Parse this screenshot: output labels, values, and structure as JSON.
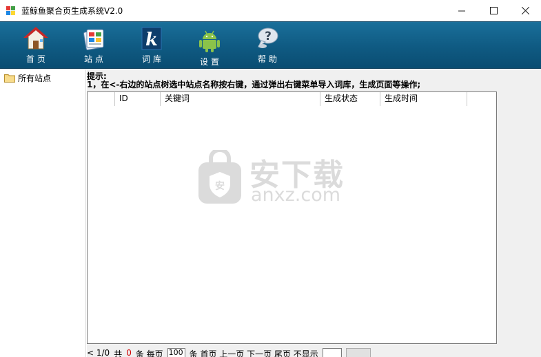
{
  "window": {
    "title": "蓝鲸鱼聚合页生成系统V2.0",
    "minimize_glyph": "—",
    "maximize_glyph": "☐",
    "close_glyph": "✕"
  },
  "toolbar": {
    "items": [
      {
        "label": "首页",
        "icon": "home-icon"
      },
      {
        "label": "站点",
        "icon": "sites-icon"
      },
      {
        "label": "词库",
        "icon": "k-icon"
      },
      {
        "label": "设置",
        "icon": "android-icon"
      },
      {
        "label": "帮助",
        "icon": "help-bubble-icon"
      }
    ]
  },
  "tree": {
    "root_label": "所有站点"
  },
  "hint": {
    "title": "提示:",
    "body": "1，在<-右边的站点树选中站点名称按右键，通过弹出右键菜单导入词库，生成页面等操作;"
  },
  "grid": {
    "columns": [
      "",
      "ID",
      "关键词",
      "生成状态",
      "生成时间"
    ]
  },
  "pager": {
    "text1": "< 1/0",
    "text2": "共",
    "count": "0",
    "text3": "条 每页",
    "page_size": "100",
    "text4": "条 首页 上一页 下一页 尾页 不显示"
  },
  "watermark": {
    "cn": "安下载",
    "en": "anxz.com"
  },
  "colors": {
    "toolbar_bg": "#0f5a82",
    "window_bg": "#f0f0f0"
  }
}
